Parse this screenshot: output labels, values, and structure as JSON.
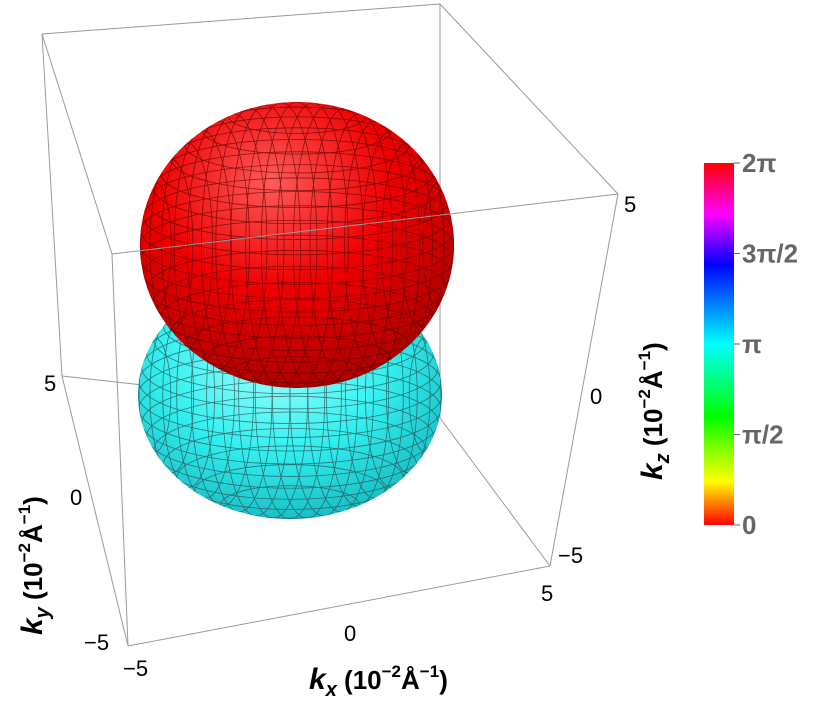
{
  "chart_data": {
    "type": "3d-surface",
    "surfaces": [
      {
        "name": "upper lobe",
        "phase": "0",
        "color": "#ff0000"
      },
      {
        "name": "lower lobe",
        "phase": "π",
        "color": "#00ffff"
      }
    ],
    "axes": {
      "x": {
        "symbol": "k",
        "subscript": "x",
        "unit_prefix": " (10",
        "unit_exp": "−2",
        "unit_base": "Å",
        "unit_exp2": "−1",
        "unit_close": ")",
        "ticks": [
          "−5",
          "0",
          "5"
        ],
        "range": [
          -5,
          5
        ]
      },
      "y": {
        "symbol": "k",
        "subscript": "y",
        "unit_prefix": " (10",
        "unit_exp": "−2",
        "unit_base": "Å",
        "unit_exp2": "−1",
        "unit_close": ")",
        "ticks": [
          "−5",
          "0",
          "5"
        ],
        "range": [
          -5,
          5
        ]
      },
      "z": {
        "symbol": "k",
        "subscript": "z",
        "unit_prefix": " (10",
        "unit_exp": "−2",
        "unit_base": "Å",
        "unit_exp2": "−1",
        "unit_close": ")",
        "ticks": [
          "−5",
          "0",
          "5"
        ],
        "range": [
          -5,
          5
        ]
      }
    },
    "colorbar": {
      "ticks": [
        "2π",
        "3π/2",
        "π",
        "π/2",
        "0"
      ],
      "values": [
        6.2832,
        4.7124,
        3.1416,
        1.5708,
        0
      ],
      "stops": [
        "#ff0000",
        "#ff00ff",
        "#0000ff",
        "#00ffff",
        "#00ff00",
        "#ffff00",
        "#ff0000"
      ]
    }
  }
}
